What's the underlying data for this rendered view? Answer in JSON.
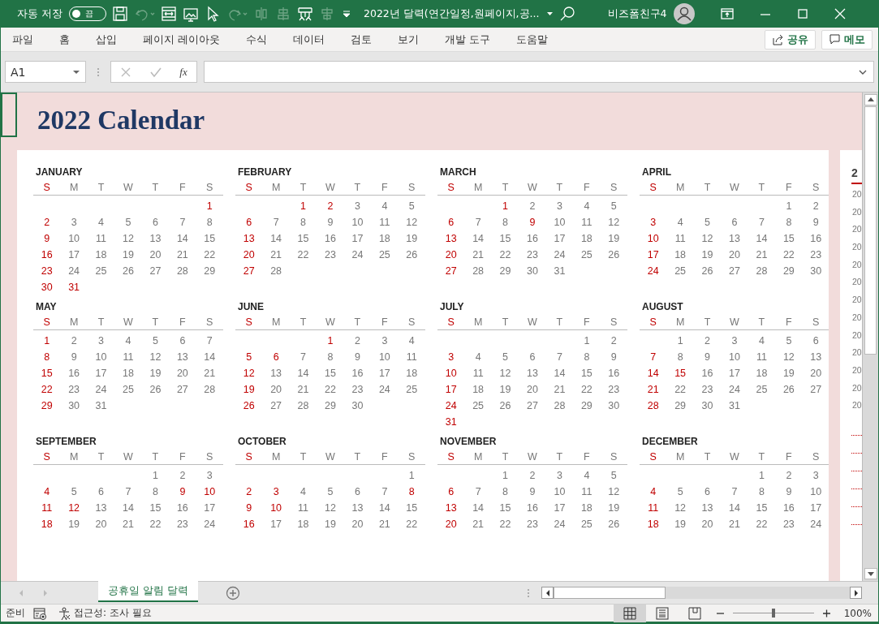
{
  "title_bar": {
    "autosave_label": "자동 저장",
    "autosave_toggle": {
      "label": "끔",
      "on": false
    },
    "document_title": "2022년 달력(연간일정,원페이지,공...",
    "user_name": "비즈폼친구4"
  },
  "ribbon_tabs": [
    "파일",
    "홈",
    "삽입",
    "페이지 레이아웃",
    "수식",
    "데이터",
    "검토",
    "보기",
    "개발 도구",
    "도움말"
  ],
  "ribbon_buttons": [
    {
      "kind": "share",
      "label": "공유"
    },
    {
      "kind": "comment",
      "label": "메모"
    }
  ],
  "formula_bar": {
    "name_box": "A1",
    "function_button": "fx"
  },
  "sheet": {
    "title": "2022 Calendar",
    "months": [
      {
        "name": "JANUARY",
        "weekdays": [
          "S",
          "M",
          "T",
          "W",
          "T",
          "F",
          "S"
        ],
        "weeks": [
          [
            {
              "day": "1",
              "holiday": true
            }
          ],
          [
            {
              "day": "2",
              "holiday": true
            },
            {
              "day": "3",
              "holiday": false
            },
            {
              "day": "4",
              "holiday": false
            },
            {
              "day": "5",
              "holiday": false
            },
            {
              "day": "6",
              "holiday": false
            },
            {
              "day": "7",
              "holiday": false
            },
            {
              "day": "8",
              "holiday": false
            }
          ],
          [
            {
              "day": "9",
              "holiday": true
            },
            {
              "day": "10",
              "holiday": false
            },
            {
              "day": "11",
              "holiday": false
            },
            {
              "day": "12",
              "holiday": false
            },
            {
              "day": "13",
              "holiday": false
            },
            {
              "day": "14",
              "holiday": false
            },
            {
              "day": "15",
              "holiday": false
            }
          ],
          [
            {
              "day": "16",
              "holiday": true
            },
            {
              "day": "17",
              "holiday": false
            },
            {
              "day": "18",
              "holiday": false
            },
            {
              "day": "19",
              "holiday": false
            },
            {
              "day": "20",
              "holiday": false
            },
            {
              "day": "21",
              "holiday": false
            },
            {
              "day": "22",
              "holiday": false
            }
          ],
          [
            {
              "day": "23",
              "holiday": true
            },
            {
              "day": "24",
              "holiday": false
            },
            {
              "day": "25",
              "holiday": false
            },
            {
              "day": "26",
              "holiday": false
            },
            {
              "day": "27",
              "holiday": false
            },
            {
              "day": "28",
              "holiday": false
            },
            {
              "day": "29",
              "holiday": false
            }
          ],
          [
            {
              "day": "30",
              "holiday": true
            },
            {
              "day": "31",
              "holiday": true
            }
          ]
        ]
      },
      {
        "name": "FEBRUARY",
        "weekdays": [
          "S",
          "M",
          "T",
          "W",
          "T",
          "F",
          "S"
        ],
        "weeks": [
          [
            {
              "day": "1",
              "holiday": true
            },
            {
              "day": "2",
              "holiday": true
            },
            {
              "day": "3",
              "holiday": false
            },
            {
              "day": "4",
              "holiday": false
            },
            {
              "day": "5",
              "holiday": false
            }
          ],
          [
            {
              "day": "6",
              "holiday": true
            },
            {
              "day": "7",
              "holiday": false
            },
            {
              "day": "8",
              "holiday": false
            },
            {
              "day": "9",
              "holiday": false
            },
            {
              "day": "10",
              "holiday": false
            },
            {
              "day": "11",
              "holiday": false
            },
            {
              "day": "12",
              "holiday": false
            }
          ],
          [
            {
              "day": "13",
              "holiday": true
            },
            {
              "day": "14",
              "holiday": false
            },
            {
              "day": "15",
              "holiday": false
            },
            {
              "day": "16",
              "holiday": false
            },
            {
              "day": "17",
              "holiday": false
            },
            {
              "day": "18",
              "holiday": false
            },
            {
              "day": "19",
              "holiday": false
            }
          ],
          [
            {
              "day": "20",
              "holiday": true
            },
            {
              "day": "21",
              "holiday": false
            },
            {
              "day": "22",
              "holiday": false
            },
            {
              "day": "23",
              "holiday": false
            },
            {
              "day": "24",
              "holiday": false
            },
            {
              "day": "25",
              "holiday": false
            },
            {
              "day": "26",
              "holiday": false
            }
          ],
          [
            {
              "day": "27",
              "holiday": true
            },
            {
              "day": "28",
              "holiday": false
            }
          ]
        ]
      },
      {
        "name": "MARCH",
        "weekdays": [
          "S",
          "M",
          "T",
          "W",
          "T",
          "F",
          "S"
        ],
        "weeks": [
          [
            {
              "day": "1",
              "holiday": true
            },
            {
              "day": "2",
              "holiday": false
            },
            {
              "day": "3",
              "holiday": false
            },
            {
              "day": "4",
              "holiday": false
            },
            {
              "day": "5",
              "holiday": false
            }
          ],
          [
            {
              "day": "6",
              "holiday": true
            },
            {
              "day": "7",
              "holiday": false
            },
            {
              "day": "8",
              "holiday": false
            },
            {
              "day": "9",
              "holiday": true
            },
            {
              "day": "10",
              "holiday": false
            },
            {
              "day": "11",
              "holiday": false
            },
            {
              "day": "12",
              "holiday": false
            }
          ],
          [
            {
              "day": "13",
              "holiday": true
            },
            {
              "day": "14",
              "holiday": false
            },
            {
              "day": "15",
              "holiday": false
            },
            {
              "day": "16",
              "holiday": false
            },
            {
              "day": "17",
              "holiday": false
            },
            {
              "day": "18",
              "holiday": false
            },
            {
              "day": "19",
              "holiday": false
            }
          ],
          [
            {
              "day": "20",
              "holiday": true
            },
            {
              "day": "21",
              "holiday": false
            },
            {
              "day": "22",
              "holiday": false
            },
            {
              "day": "23",
              "holiday": false
            },
            {
              "day": "24",
              "holiday": false
            },
            {
              "day": "25",
              "holiday": false
            },
            {
              "day": "26",
              "holiday": false
            }
          ],
          [
            {
              "day": "27",
              "holiday": true
            },
            {
              "day": "28",
              "holiday": false
            },
            {
              "day": "29",
              "holiday": false
            },
            {
              "day": "30",
              "holiday": false
            },
            {
              "day": "31",
              "holiday": false
            }
          ]
        ]
      },
      {
        "name": "APRIL",
        "weekdays": [
          "S",
          "M",
          "T",
          "W",
          "T",
          "F",
          "S"
        ],
        "weeks": [
          [
            {
              "day": "1",
              "holiday": false
            },
            {
              "day": "2",
              "holiday": false
            }
          ],
          [
            {
              "day": "3",
              "holiday": true
            },
            {
              "day": "4",
              "holiday": false
            },
            {
              "day": "5",
              "holiday": false
            },
            {
              "day": "6",
              "holiday": false
            },
            {
              "day": "7",
              "holiday": false
            },
            {
              "day": "8",
              "holiday": false
            },
            {
              "day": "9",
              "holiday": false
            }
          ],
          [
            {
              "day": "10",
              "holiday": true
            },
            {
              "day": "11",
              "holiday": false
            },
            {
              "day": "12",
              "holiday": false
            },
            {
              "day": "13",
              "holiday": false
            },
            {
              "day": "14",
              "holiday": false
            },
            {
              "day": "15",
              "holiday": false
            },
            {
              "day": "16",
              "holiday": false
            }
          ],
          [
            {
              "day": "17",
              "holiday": true
            },
            {
              "day": "18",
              "holiday": false
            },
            {
              "day": "19",
              "holiday": false
            },
            {
              "day": "20",
              "holiday": false
            },
            {
              "day": "21",
              "holiday": false
            },
            {
              "day": "22",
              "holiday": false
            },
            {
              "day": "23",
              "holiday": false
            }
          ],
          [
            {
              "day": "24",
              "holiday": true
            },
            {
              "day": "25",
              "holiday": false
            },
            {
              "day": "26",
              "holiday": false
            },
            {
              "day": "27",
              "holiday": false
            },
            {
              "day": "28",
              "holiday": false
            },
            {
              "day": "29",
              "holiday": false
            },
            {
              "day": "30",
              "holiday": false
            }
          ]
        ]
      },
      {
        "name": "MAY",
        "weekdays": [
          "S",
          "M",
          "T",
          "W",
          "T",
          "F",
          "S"
        ],
        "weeks": [
          [
            {
              "day": "1",
              "holiday": true
            },
            {
              "day": "2",
              "holiday": false
            },
            {
              "day": "3",
              "holiday": false
            },
            {
              "day": "4",
              "holiday": false
            },
            {
              "day": "5",
              "holiday": false
            },
            {
              "day": "6",
              "holiday": false
            },
            {
              "day": "7",
              "holiday": false
            }
          ],
          [
            {
              "day": "8",
              "holiday": true
            },
            {
              "day": "9",
              "holiday": false
            },
            {
              "day": "10",
              "holiday": false
            },
            {
              "day": "11",
              "holiday": false
            },
            {
              "day": "12",
              "holiday": false
            },
            {
              "day": "13",
              "holiday": false
            },
            {
              "day": "14",
              "holiday": false
            }
          ],
          [
            {
              "day": "15",
              "holiday": true
            },
            {
              "day": "16",
              "holiday": false
            },
            {
              "day": "17",
              "holiday": false
            },
            {
              "day": "18",
              "holiday": false
            },
            {
              "day": "19",
              "holiday": false
            },
            {
              "day": "20",
              "holiday": false
            },
            {
              "day": "21",
              "holiday": false
            }
          ],
          [
            {
              "day": "22",
              "holiday": true
            },
            {
              "day": "23",
              "holiday": false
            },
            {
              "day": "24",
              "holiday": false
            },
            {
              "day": "25",
              "holiday": false
            },
            {
              "day": "26",
              "holiday": false
            },
            {
              "day": "27",
              "holiday": false
            },
            {
              "day": "28",
              "holiday": false
            }
          ],
          [
            {
              "day": "29",
              "holiday": true
            },
            {
              "day": "30",
              "holiday": false
            },
            {
              "day": "31",
              "holiday": false
            }
          ]
        ]
      },
      {
        "name": "JUNE",
        "weekdays": [
          "S",
          "M",
          "T",
          "W",
          "T",
          "F",
          "S"
        ],
        "weeks": [
          [
            {
              "day": "1",
              "holiday": true
            },
            {
              "day": "2",
              "holiday": false
            },
            {
              "day": "3",
              "holiday": false
            },
            {
              "day": "4",
              "holiday": false
            }
          ],
          [
            {
              "day": "5",
              "holiday": true
            },
            {
              "day": "6",
              "holiday": true
            },
            {
              "day": "7",
              "holiday": false
            },
            {
              "day": "8",
              "holiday": false
            },
            {
              "day": "9",
              "holiday": false
            },
            {
              "day": "10",
              "holiday": false
            },
            {
              "day": "11",
              "holiday": false
            }
          ],
          [
            {
              "day": "12",
              "holiday": true
            },
            {
              "day": "13",
              "holiday": false
            },
            {
              "day": "14",
              "holiday": false
            },
            {
              "day": "15",
              "holiday": false
            },
            {
              "day": "16",
              "holiday": false
            },
            {
              "day": "17",
              "holiday": false
            },
            {
              "day": "18",
              "holiday": false
            }
          ],
          [
            {
              "day": "19",
              "holiday": true
            },
            {
              "day": "20",
              "holiday": false
            },
            {
              "day": "21",
              "holiday": false
            },
            {
              "day": "22",
              "holiday": false
            },
            {
              "day": "23",
              "holiday": false
            },
            {
              "day": "24",
              "holiday": false
            },
            {
              "day": "25",
              "holiday": false
            }
          ],
          [
            {
              "day": "26",
              "holiday": true
            },
            {
              "day": "27",
              "holiday": false
            },
            {
              "day": "28",
              "holiday": false
            },
            {
              "day": "29",
              "holiday": false
            },
            {
              "day": "30",
              "holiday": false
            }
          ]
        ]
      },
      {
        "name": "JULY",
        "weekdays": [
          "S",
          "M",
          "T",
          "W",
          "T",
          "F",
          "S"
        ],
        "weeks": [
          [
            {
              "day": "1",
              "holiday": false
            },
            {
              "day": "2",
              "holiday": false
            }
          ],
          [
            {
              "day": "3",
              "holiday": true
            },
            {
              "day": "4",
              "holiday": false
            },
            {
              "day": "5",
              "holiday": false
            },
            {
              "day": "6",
              "holiday": false
            },
            {
              "day": "7",
              "holiday": false
            },
            {
              "day": "8",
              "holiday": false
            },
            {
              "day": "9",
              "holiday": false
            }
          ],
          [
            {
              "day": "10",
              "holiday": true
            },
            {
              "day": "11",
              "holiday": false
            },
            {
              "day": "12",
              "holiday": false
            },
            {
              "day": "13",
              "holiday": false
            },
            {
              "day": "14",
              "holiday": false
            },
            {
              "day": "15",
              "holiday": false
            },
            {
              "day": "16",
              "holiday": false
            }
          ],
          [
            {
              "day": "17",
              "holiday": true
            },
            {
              "day": "18",
              "holiday": false
            },
            {
              "day": "19",
              "holiday": false
            },
            {
              "day": "20",
              "holiday": false
            },
            {
              "day": "21",
              "holiday": false
            },
            {
              "day": "22",
              "holiday": false
            },
            {
              "day": "23",
              "holiday": false
            }
          ],
          [
            {
              "day": "24",
              "holiday": true
            },
            {
              "day": "25",
              "holiday": false
            },
            {
              "day": "26",
              "holiday": false
            },
            {
              "day": "27",
              "holiday": false
            },
            {
              "day": "28",
              "holiday": false
            },
            {
              "day": "29",
              "holiday": false
            },
            {
              "day": "30",
              "holiday": false
            }
          ],
          [
            {
              "day": "31",
              "holiday": true
            }
          ]
        ]
      },
      {
        "name": "AUGUST",
        "weekdays": [
          "S",
          "M",
          "T",
          "W",
          "T",
          "F",
          "S"
        ],
        "weeks": [
          [
            {
              "day": "1",
              "holiday": false
            },
            {
              "day": "2",
              "holiday": false
            },
            {
              "day": "3",
              "holiday": false
            },
            {
              "day": "4",
              "holiday": false
            },
            {
              "day": "5",
              "holiday": false
            },
            {
              "day": "6",
              "holiday": false
            }
          ],
          [
            {
              "day": "7",
              "holiday": true
            },
            {
              "day": "8",
              "holiday": false
            },
            {
              "day": "9",
              "holiday": false
            },
            {
              "day": "10",
              "holiday": false
            },
            {
              "day": "11",
              "holiday": false
            },
            {
              "day": "12",
              "holiday": false
            },
            {
              "day": "13",
              "holiday": false
            }
          ],
          [
            {
              "day": "14",
              "holiday": true
            },
            {
              "day": "15",
              "holiday": true
            },
            {
              "day": "16",
              "holiday": false
            },
            {
              "day": "17",
              "holiday": false
            },
            {
              "day": "18",
              "holiday": false
            },
            {
              "day": "19",
              "holiday": false
            },
            {
              "day": "20",
              "holiday": false
            }
          ],
          [
            {
              "day": "21",
              "holiday": true
            },
            {
              "day": "22",
              "holiday": false
            },
            {
              "day": "23",
              "holiday": false
            },
            {
              "day": "24",
              "holiday": false
            },
            {
              "day": "25",
              "holiday": false
            },
            {
              "day": "26",
              "holiday": false
            },
            {
              "day": "27",
              "holiday": false
            }
          ],
          [
            {
              "day": "28",
              "holiday": true
            },
            {
              "day": "29",
              "holiday": false
            },
            {
              "day": "30",
              "holiday": false
            },
            {
              "day": "31",
              "holiday": false
            }
          ]
        ]
      },
      {
        "name": "SEPTEMBER",
        "weekdays": [
          "S",
          "M",
          "T",
          "W",
          "T",
          "F",
          "S"
        ],
        "weeks": [
          [
            {
              "day": "1",
              "holiday": false
            },
            {
              "day": "2",
              "holiday": false
            },
            {
              "day": "3",
              "holiday": false
            }
          ],
          [
            {
              "day": "4",
              "holiday": true
            },
            {
              "day": "5",
              "holiday": false
            },
            {
              "day": "6",
              "holiday": false
            },
            {
              "day": "7",
              "holiday": false
            },
            {
              "day": "8",
              "holiday": false
            },
            {
              "day": "9",
              "holiday": true
            },
            {
              "day": "10",
              "holiday": true
            }
          ],
          [
            {
              "day": "11",
              "holiday": true
            },
            {
              "day": "12",
              "holiday": true
            },
            {
              "day": "13",
              "holiday": false
            },
            {
              "day": "14",
              "holiday": false
            },
            {
              "day": "15",
              "holiday": false
            },
            {
              "day": "16",
              "holiday": false
            },
            {
              "day": "17",
              "holiday": false
            }
          ],
          [
            {
              "day": "18",
              "holiday": true
            },
            {
              "day": "19",
              "holiday": false
            },
            {
              "day": "20",
              "holiday": false
            },
            {
              "day": "21",
              "holiday": false
            },
            {
              "day": "22",
              "holiday": false
            },
            {
              "day": "23",
              "holiday": false
            },
            {
              "day": "24",
              "holiday": false
            }
          ]
        ]
      },
      {
        "name": "OCTOBER",
        "weekdays": [
          "S",
          "M",
          "T",
          "W",
          "T",
          "F",
          "S"
        ],
        "weeks": [
          [
            {
              "day": "1",
              "holiday": false
            }
          ],
          [
            {
              "day": "2",
              "holiday": true
            },
            {
              "day": "3",
              "holiday": true
            },
            {
              "day": "4",
              "holiday": false
            },
            {
              "day": "5",
              "holiday": false
            },
            {
              "day": "6",
              "holiday": false
            },
            {
              "day": "7",
              "holiday": false
            },
            {
              "day": "8",
              "holiday": true
            }
          ],
          [
            {
              "day": "9",
              "holiday": true
            },
            {
              "day": "10",
              "holiday": true
            },
            {
              "day": "11",
              "holiday": false
            },
            {
              "day": "12",
              "holiday": false
            },
            {
              "day": "13",
              "holiday": false
            },
            {
              "day": "14",
              "holiday": false
            },
            {
              "day": "15",
              "holiday": false
            }
          ],
          [
            {
              "day": "16",
              "holiday": true
            },
            {
              "day": "17",
              "holiday": false
            },
            {
              "day": "18",
              "holiday": false
            },
            {
              "day": "19",
              "holiday": false
            },
            {
              "day": "20",
              "holiday": false
            },
            {
              "day": "21",
              "holiday": false
            },
            {
              "day": "22",
              "holiday": false
            }
          ]
        ]
      },
      {
        "name": "NOVEMBER",
        "weekdays": [
          "S",
          "M",
          "T",
          "W",
          "T",
          "F",
          "S"
        ],
        "weeks": [
          [
            {
              "day": "1",
              "holiday": false
            },
            {
              "day": "2",
              "holiday": false
            },
            {
              "day": "3",
              "holiday": false
            },
            {
              "day": "4",
              "holiday": false
            },
            {
              "day": "5",
              "holiday": false
            }
          ],
          [
            {
              "day": "6",
              "holiday": true
            },
            {
              "day": "7",
              "holiday": false
            },
            {
              "day": "8",
              "holiday": false
            },
            {
              "day": "9",
              "holiday": false
            },
            {
              "day": "10",
              "holiday": false
            },
            {
              "day": "11",
              "holiday": false
            },
            {
              "day": "12",
              "holiday": false
            }
          ],
          [
            {
              "day": "13",
              "holiday": true
            },
            {
              "day": "14",
              "holiday": false
            },
            {
              "day": "15",
              "holiday": false
            },
            {
              "day": "16",
              "holiday": false
            },
            {
              "day": "17",
              "holiday": false
            },
            {
              "day": "18",
              "holiday": false
            },
            {
              "day": "19",
              "holiday": false
            }
          ],
          [
            {
              "day": "20",
              "holiday": true
            },
            {
              "day": "21",
              "holiday": false
            },
            {
              "day": "22",
              "holiday": false
            },
            {
              "day": "23",
              "holiday": false
            },
            {
              "day": "24",
              "holiday": false
            },
            {
              "day": "25",
              "holiday": false
            },
            {
              "day": "26",
              "holiday": false
            }
          ]
        ]
      },
      {
        "name": "DECEMBER",
        "weekdays": [
          "S",
          "M",
          "T",
          "W",
          "T",
          "F",
          "S"
        ],
        "weeks": [
          [
            {
              "day": "1",
              "holiday": false
            },
            {
              "day": "2",
              "holiday": false
            },
            {
              "day": "3",
              "holiday": false
            }
          ],
          [
            {
              "day": "4",
              "holiday": true
            },
            {
              "day": "5",
              "holiday": false
            },
            {
              "day": "6",
              "holiday": false
            },
            {
              "day": "7",
              "holiday": false
            },
            {
              "day": "8",
              "holiday": false
            },
            {
              "day": "9",
              "holiday": false
            },
            {
              "day": "10",
              "holiday": false
            }
          ],
          [
            {
              "day": "11",
              "holiday": true
            },
            {
              "day": "12",
              "holiday": false
            },
            {
              "day": "13",
              "holiday": false
            },
            {
              "day": "14",
              "holiday": false
            },
            {
              "day": "15",
              "holiday": false
            },
            {
              "day": "16",
              "holiday": false
            },
            {
              "day": "17",
              "holiday": false
            }
          ],
          [
            {
              "day": "18",
              "holiday": true
            },
            {
              "day": "19",
              "holiday": false
            },
            {
              "day": "20",
              "holiday": false
            },
            {
              "day": "21",
              "holiday": false
            },
            {
              "day": "22",
              "holiday": false
            },
            {
              "day": "23",
              "holiday": false
            },
            {
              "day": "24",
              "holiday": false
            }
          ]
        ]
      }
    ],
    "side_column": {
      "heading": "2",
      "items": [
        "20",
        "20",
        "20",
        "20",
        "20",
        "20",
        "20",
        "20",
        "20",
        "20",
        "20",
        "20",
        "20"
      ]
    }
  },
  "sheet_tabs": [
    {
      "label": "공휴일 알림 달력",
      "selected": true
    }
  ],
  "status_bar": {
    "mode": "준비",
    "accessibility": "접근성: 조사 필요",
    "views": [
      {
        "kind": "normal",
        "selected": true
      },
      {
        "kind": "page_layout",
        "selected": false
      },
      {
        "kind": "page_break",
        "selected": false
      }
    ],
    "zoom": {
      "level": 0.5,
      "label": "100%"
    }
  }
}
